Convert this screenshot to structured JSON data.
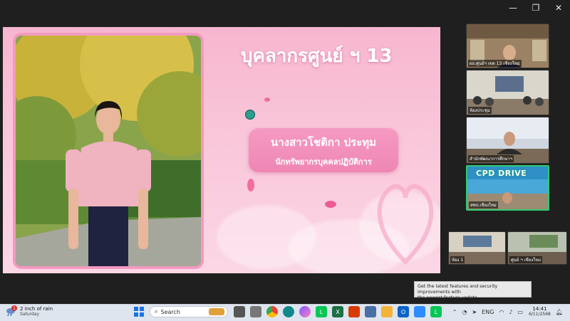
{
  "window": {
    "minimize": "—",
    "restore": "❐",
    "close": "✕"
  },
  "slide": {
    "title": "บุคลากรศูนย์ ฯ 13",
    "person_name": "นางสาวโชติกา ประทุม",
    "person_role": "นักทรัพยากรบุคคลปฏิบัติการ",
    "accent": "#f39ac0"
  },
  "participants": [
    {
      "label": "ผอ.ศูนย์ฯ เขต 13 เชียงใหม่"
    },
    {
      "label": "ห้องประชุม"
    },
    {
      "label": "สำนักพัฒนาการศึกษาฯ"
    },
    {
      "banner": "CPD DRIVE",
      "label": "สพป.เชียงใหม่"
    },
    {
      "label": "ห้อง 1"
    },
    {
      "label": "ศูนย์ ฯ เชียงใหม่"
    }
  ],
  "toast": {
    "line1": "Get the latest features and security improvements with",
    "line2": "the newest feature update."
  },
  "taskbar": {
    "weather_badge": "1",
    "weather_title": "2 inch of rain",
    "weather_day": "Saturday",
    "search_placeholder": "Search",
    "language": "ENG",
    "time": "14:41",
    "date": "6/11/2568"
  }
}
